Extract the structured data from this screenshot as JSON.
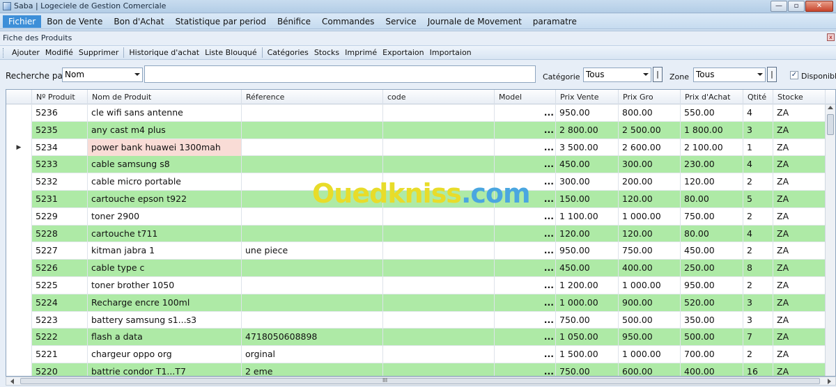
{
  "window": {
    "title": "Saba | Logeciele de Gestion Comerciale",
    "buttons": [
      "—",
      "▫",
      "✕"
    ]
  },
  "menu": [
    {
      "label": "Fichier",
      "active": true
    },
    {
      "label": "Bon de Vente"
    },
    {
      "label": "Bon d'Achat"
    },
    {
      "label": "Statistique par period"
    },
    {
      "label": "Bénifice"
    },
    {
      "label": "Commandes"
    },
    {
      "label": "Service"
    },
    {
      "label": "Journale de Movement"
    },
    {
      "label": "paramatre"
    }
  ],
  "panel": {
    "title": "Fiche des Produits",
    "close": "x"
  },
  "toolbar": {
    "group1": [
      "Ajouter",
      "Modifié",
      "Supprimer"
    ],
    "group2": [
      "Historique d'achat",
      "Liste Blouqué"
    ],
    "group3": [
      "Catégories",
      "Stocks",
      "Imprimé",
      "Exportaion",
      "Importaion"
    ]
  },
  "search": {
    "label": "Recherche par",
    "field": "Nom",
    "value": "",
    "category_label": "Catégorie",
    "category_value": "Tous",
    "zone_label": "Zone",
    "zone_value": "Tous",
    "small_button": "|",
    "disponible_label": "Disponible",
    "disponible_checked": true
  },
  "grid": {
    "columns": [
      "Nº Produit",
      "Nom de Produit",
      "Réference",
      "code",
      "Model",
      "Prix Vente",
      "Prix Gro",
      "Prix d'Achat",
      "Qtité",
      "Stocke"
    ],
    "selected_row": 2,
    "highlight_cell": {
      "row": 2,
      "col": 1
    },
    "rows": [
      [
        "5236",
        "cle wifi sans antenne",
        "",
        "",
        "...",
        "950.00",
        "800.00",
        "550.00",
        "4",
        "ZA"
      ],
      [
        "5235",
        "any cast m4 plus",
        "",
        "",
        "...",
        "2 800.00",
        "2 500.00",
        "1 800.00",
        "3",
        "ZA"
      ],
      [
        "5234",
        "power bank huawei 1300mah",
        "",
        "",
        "...",
        "3 500.00",
        "2 600.00",
        "2 100.00",
        "1",
        "ZA"
      ],
      [
        "5233",
        "cable samsung s8",
        "",
        "",
        "...",
        "450.00",
        "300.00",
        "230.00",
        "4",
        "ZA"
      ],
      [
        "5232",
        "cable micro portable",
        "",
        "",
        "...",
        "300.00",
        "200.00",
        "120.00",
        "2",
        "ZA"
      ],
      [
        "5231",
        "cartouche epson t922",
        "",
        "",
        "...",
        "150.00",
        "120.00",
        "80.00",
        "5",
        "ZA"
      ],
      [
        "5229",
        "toner 2900",
        "",
        "",
        "...",
        "1 100.00",
        "1 000.00",
        "750.00",
        "2",
        "ZA"
      ],
      [
        "5228",
        "cartouche t711",
        "",
        "",
        "...",
        "120.00",
        "120.00",
        "80.00",
        "4",
        "ZA"
      ],
      [
        "5227",
        "kitman jabra 1",
        "une piece",
        "",
        "...",
        "950.00",
        "750.00",
        "450.00",
        "2",
        "ZA"
      ],
      [
        "5226",
        "cable type c",
        "",
        "",
        "...",
        "450.00",
        "400.00",
        "250.00",
        "8",
        "ZA"
      ],
      [
        "5225",
        "toner brother 1050",
        "",
        "",
        "...",
        "1 200.00",
        "1 000.00",
        "950.00",
        "2",
        "ZA"
      ],
      [
        "5224",
        "Recharge encre 100ml",
        "",
        "",
        "...",
        "1 000.00",
        "900.00",
        "520.00",
        "3",
        "ZA"
      ],
      [
        "5223",
        "battery samsung s1...s3",
        "",
        "",
        "...",
        "750.00",
        "500.00",
        "350.00",
        "3",
        "ZA"
      ],
      [
        "5222",
        "flash a data",
        "4718050608898",
        "",
        "...",
        "1 050.00",
        "950.00",
        "500.00",
        "7",
        "ZA"
      ],
      [
        "5221",
        "chargeur oppo org",
        "orginal",
        "",
        "...",
        "1 500.00",
        "1 000.00",
        "700.00",
        "2",
        "ZA"
      ],
      [
        "5220",
        "battrie condor T1...T7",
        "2 eme",
        "",
        "...",
        "750.00",
        "600.00",
        "400.00",
        "16",
        "ZA"
      ]
    ]
  },
  "watermark": {
    "part1": "Oued",
    "part2": "kniss",
    "part3": ".com"
  },
  "scroll_glyph": "III",
  "colors": {
    "row_alt": "#aeeaa6",
    "highlight": "#f9dcd6",
    "menu_active": "#3d8fd8"
  }
}
